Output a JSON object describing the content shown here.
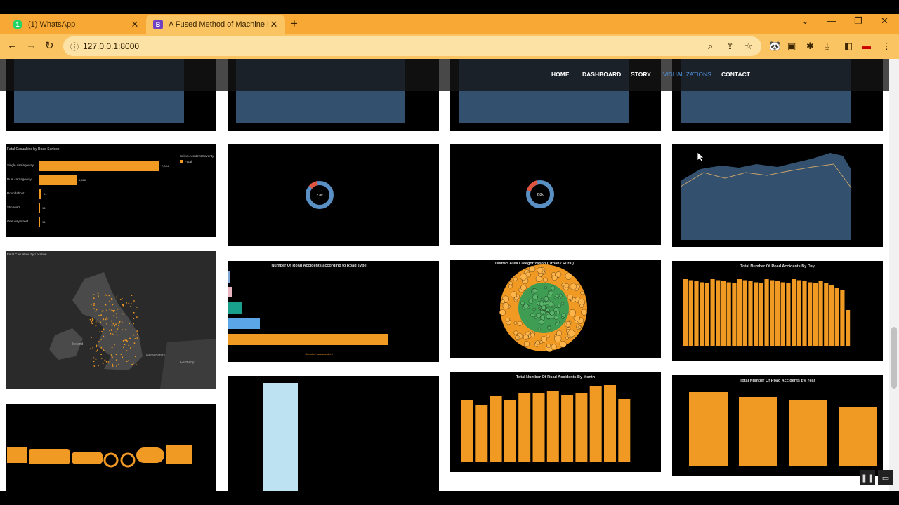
{
  "browser": {
    "tabs": [
      {
        "title": "(1) WhatsApp",
        "favicon": "whatsapp-icon",
        "badge": "1",
        "active": false
      },
      {
        "title": "A Fused Method of Machine Lear",
        "favicon": "bootstrap-icon",
        "badge": "B",
        "active": true
      }
    ],
    "url": "127.0.0.1:8000",
    "colors": {
      "tabstrip": "#f8a935",
      "toolbar": "#fbc463"
    }
  },
  "site_nav": {
    "items": [
      {
        "label": "HOME"
      },
      {
        "label": "DASHBOARD"
      },
      {
        "label": "STORY"
      },
      {
        "label": "VISUALIZATIONS",
        "active": true
      },
      {
        "label": "CONTACT"
      }
    ]
  },
  "charts": {
    "road_surface": {
      "title": "Fatal Casualties by Road Surface",
      "legend_title": "Select Accident Severity",
      "legend_item": "Fatal",
      "categories": [
        "Single carriageway",
        "Dual carriageway",
        "Roundabout",
        "Slip road",
        "One way street"
      ],
      "values": [
        "7,064",
        "1,666",
        "94",
        "16",
        "14"
      ]
    },
    "donut1": {
      "center": "2.8k"
    },
    "donut2": {
      "center": "2.8k"
    },
    "road_type": {
      "title": "Number Of Road Accidents according to Road Type",
      "xlabel": "Count of roadaccident"
    },
    "district": {
      "title": "District Area Categorization (Urban / Rural)"
    },
    "by_day": {
      "title": "Total Number Of Road Accidents By Day"
    },
    "by_month": {
      "title": "Total Number Of Road Accidents By Month"
    },
    "by_year": {
      "title": "Total Number Of Road Accidents By Year"
    },
    "map": {
      "title": "Fatal Casualties by Location",
      "labels": [
        "Ireland",
        "Netherlands",
        "Germany"
      ]
    }
  },
  "colors": {
    "orange": "#f19a23",
    "navy": "#33506e",
    "green": "#3f9c53",
    "light_blue": "#bde3f3"
  }
}
